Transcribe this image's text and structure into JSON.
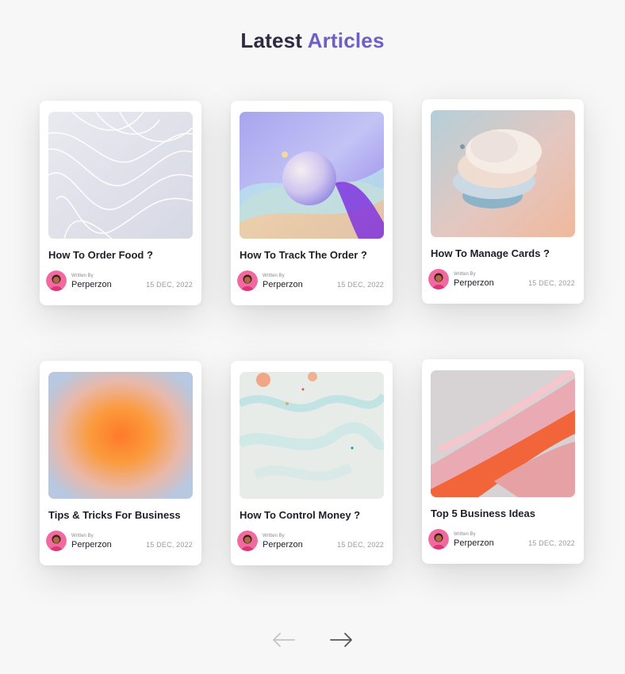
{
  "header": {
    "title_part1": "Latest",
    "title_part2": "Articles"
  },
  "articles": [
    {
      "title": "How To Order Food ?",
      "written_by": "Written By",
      "author": "Perperzon",
      "date": "15 DEC, 2022",
      "image": "white-waves-image"
    },
    {
      "title": "How To Track The Order ?",
      "written_by": "Written By",
      "author": "Perperzon",
      "date": "15 DEC, 2022",
      "image": "sphere-image"
    },
    {
      "title": "How To Manage Cards ?",
      "written_by": "Written By",
      "author": "Perperzon",
      "date": "15 DEC, 2022",
      "image": "stacked-discs-image"
    },
    {
      "title": "Tips & Tricks For Business",
      "written_by": "Written By",
      "author": "Perperzon",
      "date": "15 DEC, 2022",
      "image": "orange-gradient-image"
    },
    {
      "title": "How To Control Money ?",
      "written_by": "Written By",
      "author": "Perperzon",
      "date": "15 DEC, 2022",
      "image": "marble-image"
    },
    {
      "title": "Top 5 Business Ideas",
      "written_by": "Written By",
      "author": "Perperzon",
      "date": "15 DEC, 2022",
      "image": "pink-strokes-image"
    }
  ],
  "pagination": {
    "prev_icon": "arrow-left-icon",
    "next_icon": "arrow-right-icon"
  },
  "colors": {
    "title_dark": "#2e2a42",
    "title_accent": "#6d5fc7",
    "prev_disabled": "#c4c4c4",
    "next_active": "#555555"
  }
}
